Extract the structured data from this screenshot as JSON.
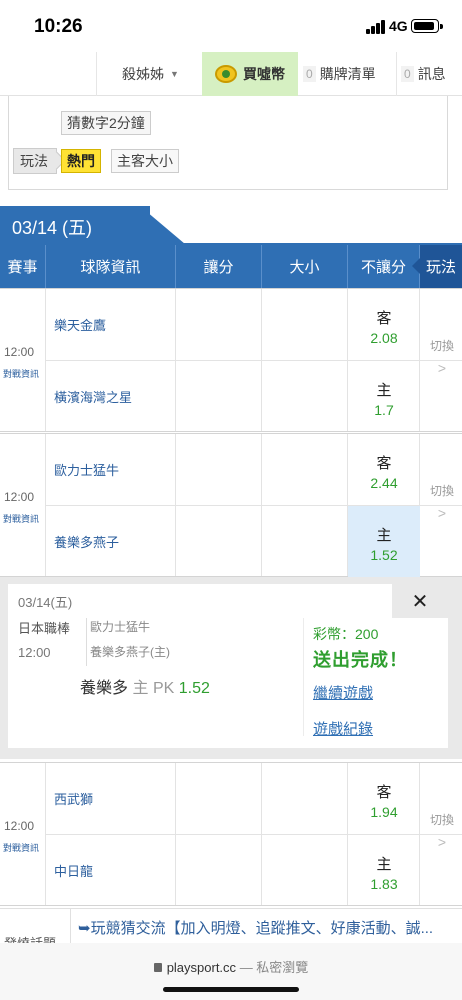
{
  "status_bar": {
    "time": "10:26",
    "network": "4G"
  },
  "top_nav": {
    "user_name": "殺姊姊",
    "buy_label": "買噓幣",
    "cart_count": "0",
    "cart_label": "購牌清單",
    "msg_count": "0",
    "msg_label": "訊息"
  },
  "filters": {
    "guess_tag": "猜數字2分鐘",
    "play_label": "玩法",
    "hot_tag": "熱門",
    "home_away_tag": "主客大小"
  },
  "date_banner": "03/14 (五)",
  "table_header": {
    "event": "賽事",
    "team_info": "球隊資訊",
    "handicap": "讓分",
    "over_under": "大小",
    "moneyline": "不讓分",
    "play": "玩法"
  },
  "games": [
    {
      "time": "12:00",
      "info_link": "對戰資訊",
      "away_team": "樂天金鷹",
      "home_team": "橫濱海灣之星",
      "away_side": "客",
      "away_odd": "2.08",
      "home_side": "主",
      "home_odd": "1.7",
      "switch_label": "切換"
    },
    {
      "time": "12:00",
      "info_link": "對戰資訊",
      "away_team": "歐力士猛牛",
      "home_team": "養樂多燕子",
      "away_side": "客",
      "away_odd": "2.44",
      "home_side": "主",
      "home_odd": "1.52",
      "switch_label": "切換"
    },
    {
      "time": "12:00",
      "info_link": "對戰資訊",
      "away_team": "西武獅",
      "home_team": "中日龍",
      "away_side": "客",
      "away_odd": "1.94",
      "home_side": "主",
      "home_odd": "1.83",
      "switch_label": "切換"
    }
  ],
  "confirmation": {
    "date": "03/14(五)",
    "league": "日本職棒",
    "time": "12:00",
    "away_team": "歐力士猛牛",
    "home_team": "養樂多燕子(主)",
    "pick_team": "養樂多",
    "pick_side": "主",
    "pick_type": "PK",
    "pick_odd": "1.52",
    "coins": "彩幣：200",
    "status": "送出完成！",
    "continue_link": "繼續遊戲",
    "record_link": "遊戲紀錄"
  },
  "ticker": {
    "label": "發燒話題",
    "text": "➥玩競猜交流【加入明燈、追蹤推文、好康活動、誠..."
  },
  "browser": {
    "url": "playsport.cc",
    "mode": "— 私密瀏覽"
  }
}
